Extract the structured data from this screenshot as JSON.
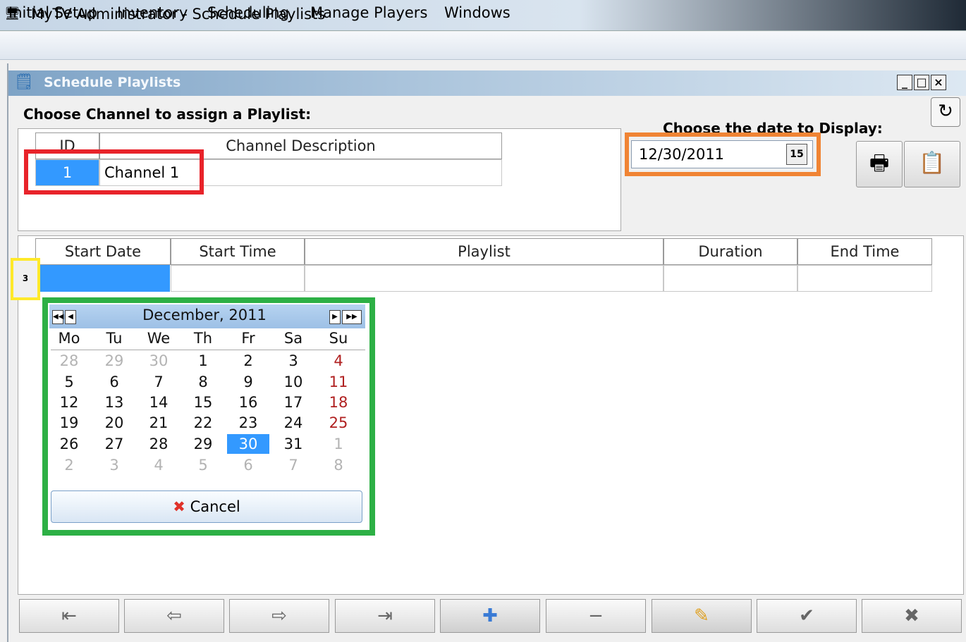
{
  "window": {
    "title": "MyTV Administrator - Schedule Playlists",
    "icon": "monitor-icon"
  },
  "menu": [
    {
      "label": "Initial Setup"
    },
    {
      "label": "Inventory"
    },
    {
      "label": "Scheduling"
    },
    {
      "label": "Manage Players"
    },
    {
      "label": "Windows"
    }
  ],
  "child": {
    "title": "Schedule Playlists",
    "minimize": "_",
    "maximize": "□",
    "close": "×"
  },
  "channels": {
    "label": "Choose Channel to assign a Playlist:",
    "columns": [
      "ID",
      "Channel Description"
    ],
    "rows": [
      {
        "id": "1",
        "description": "Channel 1"
      }
    ]
  },
  "date_picker": {
    "label": "Choose the date to Display:",
    "value": "12/30/2011",
    "button": "15"
  },
  "schedule": {
    "columns": [
      "Start Date",
      "Start Time",
      "Playlist",
      "Duration",
      "End Time"
    ],
    "row_handle": "3"
  },
  "calendar": {
    "month": "December, 2011",
    "weekdays": [
      "Mo",
      "Tu",
      "We",
      "Th",
      "Fr",
      "Sa",
      "Su"
    ],
    "weeks": [
      [
        "28",
        "29",
        "30",
        "1",
        "2",
        "3",
        "4"
      ],
      [
        "5",
        "6",
        "7",
        "8",
        "9",
        "10",
        "11"
      ],
      [
        "12",
        "13",
        "14",
        "15",
        "16",
        "17",
        "18"
      ],
      [
        "19",
        "20",
        "21",
        "22",
        "23",
        "24",
        "25"
      ],
      [
        "26",
        "27",
        "28",
        "29",
        "30",
        "31",
        "1"
      ],
      [
        "2",
        "3",
        "4",
        "5",
        "6",
        "7",
        "8"
      ]
    ],
    "selected": "30",
    "cancel": "Cancel"
  },
  "colors": {
    "selection": "#3399ff",
    "highlight_red": "#e8232a",
    "highlight_orange": "#f08434",
    "highlight_green": "#2db045",
    "highlight_yellow": "#ffe92a"
  }
}
